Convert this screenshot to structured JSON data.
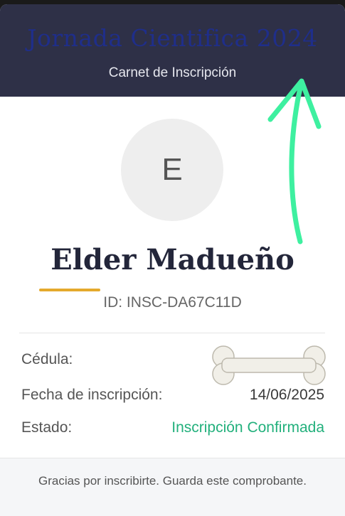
{
  "header": {
    "title": "Jornada Cientifica 2024",
    "subtitle": "Carnet de Inscripción"
  },
  "profile": {
    "avatar_initial": "E",
    "name": "Elder Madueño",
    "id_text": "ID: INSC-DA67C11D"
  },
  "details": {
    "cedula_label": "Cédula:",
    "cedula_value": "",
    "fecha_label": "Fecha de inscripción:",
    "fecha_value": "14/06/2025",
    "estado_label": "Estado:",
    "estado_value": "Inscripción Confirmada"
  },
  "footer": {
    "text": "Gracias por inscribirte. Guarda este comprobante."
  },
  "colors": {
    "header_bg": "#2e3047",
    "title_color": "#1f2e8a",
    "status_green": "#22b07c",
    "accent_underline": "#e4a92c",
    "annotation_arrow": "#3ef0a0"
  },
  "icons": {
    "redaction": "bone-sticker-icon",
    "annotation": "hand-drawn-arrow-icon"
  }
}
